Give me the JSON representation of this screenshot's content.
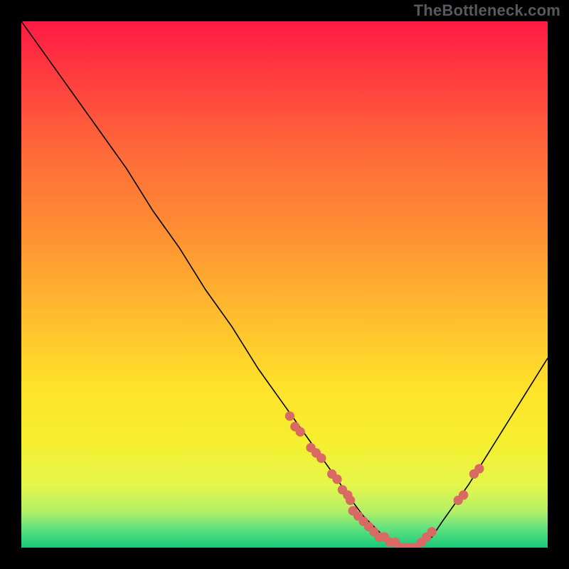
{
  "watermark": {
    "text": "TheBottleneck.com"
  },
  "chart_data": {
    "type": "line",
    "title": "",
    "xlabel": "",
    "ylabel": "",
    "xlim": [
      0,
      100
    ],
    "ylim": [
      0,
      100
    ],
    "grid": false,
    "legend": false,
    "series": [
      {
        "name": "bottleneck-curve",
        "color": "#000000",
        "x": [
          0,
          5,
          10,
          15,
          20,
          25,
          30,
          35,
          40,
          45,
          50,
          55,
          60,
          62,
          65,
          68,
          70,
          73,
          75,
          78,
          80,
          85,
          90,
          95,
          100
        ],
        "y": [
          100,
          93,
          86,
          79,
          72,
          64,
          57,
          49,
          42,
          34,
          27,
          20,
          13,
          10,
          6,
          3,
          1,
          0,
          0,
          2,
          5,
          12,
          20,
          28,
          36
        ]
      }
    ],
    "scatter": [
      {
        "name": "markers-left",
        "color": "#d96a63",
        "x": [
          51,
          52,
          53,
          55,
          56,
          57,
          59,
          60,
          61,
          62,
          62.5
        ],
        "y": [
          25,
          23,
          22,
          19,
          18,
          17,
          14,
          13,
          11,
          10,
          9
        ]
      },
      {
        "name": "markers-valley",
        "color": "#d96a63",
        "x": [
          63,
          64,
          65,
          66,
          67,
          68,
          69,
          70,
          71,
          72,
          73,
          74,
          75,
          76,
          77,
          78
        ],
        "y": [
          7,
          6,
          5,
          4,
          3,
          2,
          2,
          1,
          1,
          0,
          0,
          0,
          0,
          1,
          2,
          3
        ]
      },
      {
        "name": "markers-right",
        "color": "#d96a63",
        "x": [
          83,
          84,
          86,
          87
        ],
        "y": [
          9,
          10,
          14,
          15
        ]
      }
    ],
    "gradient_background": {
      "orientation": "vertical",
      "stops": [
        {
          "offset": 0.0,
          "color": "#ff1a44"
        },
        {
          "offset": 0.1,
          "color": "#ff3b3f"
        },
        {
          "offset": 0.25,
          "color": "#ff6a39"
        },
        {
          "offset": 0.4,
          "color": "#ff8f33"
        },
        {
          "offset": 0.55,
          "color": "#ffba2e"
        },
        {
          "offset": 0.7,
          "color": "#ffe32a"
        },
        {
          "offset": 0.8,
          "color": "#f5ef2f"
        },
        {
          "offset": 0.88,
          "color": "#e6f54a"
        },
        {
          "offset": 0.93,
          "color": "#b5f066"
        },
        {
          "offset": 0.965,
          "color": "#5fe07f"
        },
        {
          "offset": 1.0,
          "color": "#16c97a"
        }
      ]
    }
  }
}
